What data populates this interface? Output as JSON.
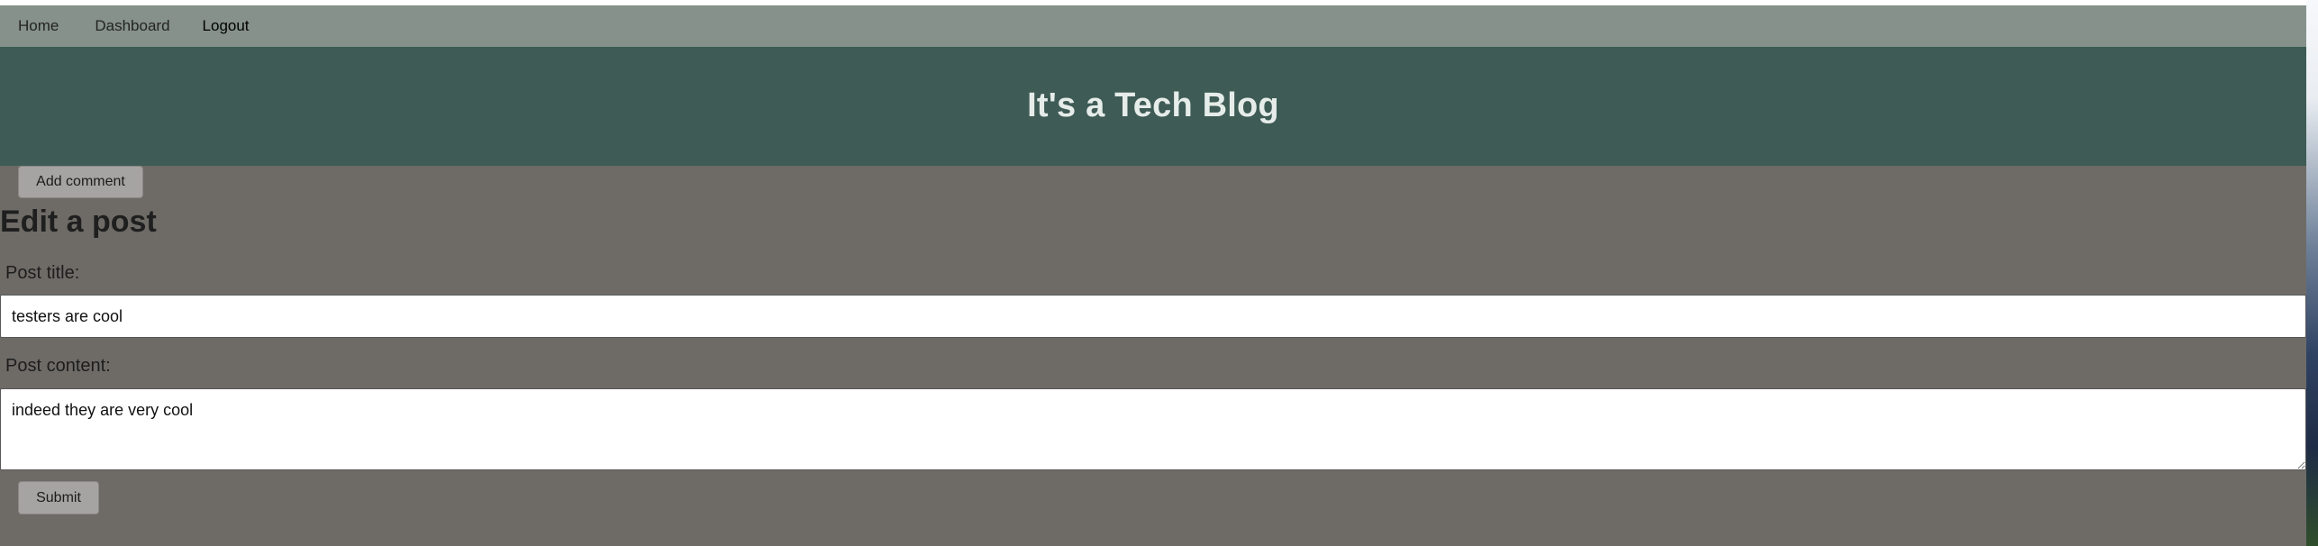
{
  "nav": {
    "home": "Home",
    "dashboard": "Dashboard",
    "logout": "Logout"
  },
  "hero": {
    "title": "It's a Tech Blog"
  },
  "actions": {
    "add_comment": "Add comment",
    "submit": "Submit"
  },
  "edit_post": {
    "heading": "Edit a post",
    "title_label": "Post title:",
    "title_value": "testers are cool",
    "content_label": "Post content:",
    "content_value": "indeed they are very cool"
  },
  "colors": {
    "page_bg": "#6e6b67",
    "nav_bg": "#86918b",
    "hero_bg": "#3e5b55",
    "hero_text": "#e6ece9",
    "button_bg": "#a6a4a2"
  }
}
